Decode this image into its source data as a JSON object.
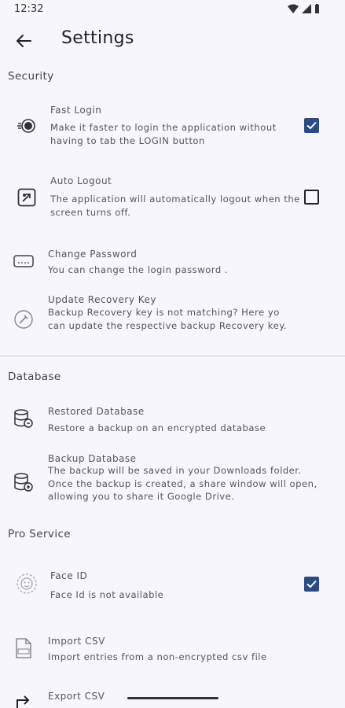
{
  "status_bar": {
    "time": "12:32"
  },
  "app_bar": {
    "title": "Settings"
  },
  "sections": {
    "security": "Security",
    "database": "Database",
    "pro_service": "Pro Service"
  },
  "items": {
    "fast_login": {
      "title": "Fast Login",
      "desc": "Make it faster to login the application without having to tab the LOGIN button",
      "checked": true,
      "icon": "fast-login-icon"
    },
    "auto_logout": {
      "title": "Auto Logout",
      "desc": "The application will automatically logout when the screen turns off.",
      "checked": false,
      "icon": "auto-logout-icon"
    },
    "change_password": {
      "title": "Change Password",
      "desc": "You can change the login password  .",
      "icon": "password-icon"
    },
    "update_recovery": {
      "title": "Update Recovery Key",
      "desc": "Backup Recovery key is not matching? Here yo can update the respective backup Recovery key.",
      "icon": "recovery-key-icon"
    },
    "restored_database": {
      "title": "Restored Database",
      "desc": "Restore a backup on an encrypted database",
      "icon": "database-restore-icon"
    },
    "backup_database": {
      "title": "Backup Database",
      "desc": "The backup will be saved in your Downloads folder. Once the backup is created, a share window will open, allowing you to share it Google Drive.",
      "icon": "database-backup-icon"
    },
    "face_id": {
      "title": "Face ID",
      "desc": "Face Id is not available",
      "checked": true,
      "icon": "face-id-icon"
    },
    "import_csv": {
      "title": "Import CSV",
      "desc": "Import entries from a non-encrypted csv file",
      "icon": "csv-file-icon"
    },
    "export_csv": {
      "title": "Export CSV",
      "icon": "export-icon"
    }
  },
  "colors": {
    "background": "#f7f6fd",
    "accent": "#2b4a88",
    "text": "#555555"
  }
}
